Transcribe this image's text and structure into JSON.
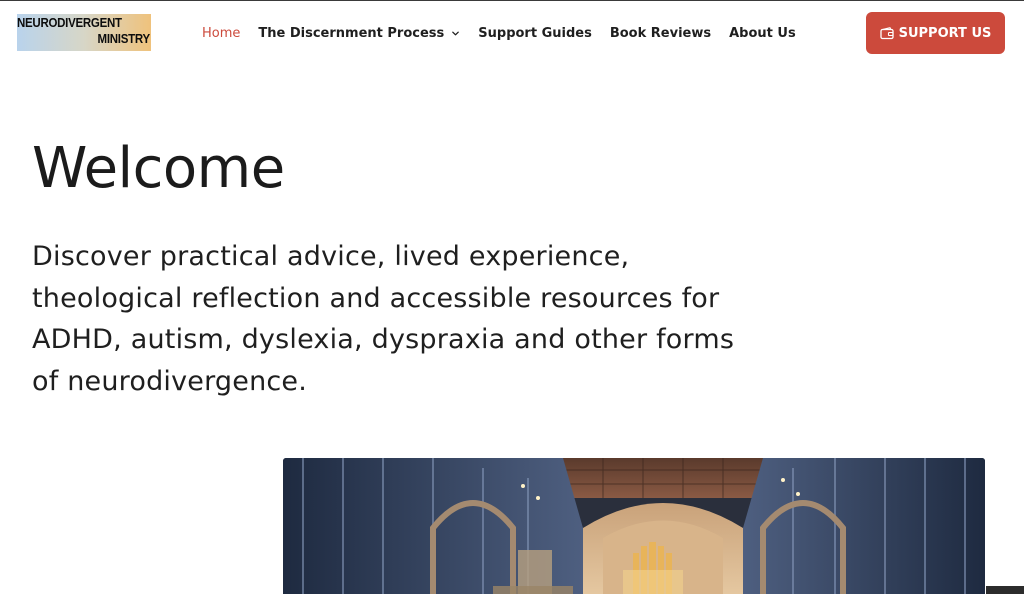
{
  "header": {
    "logo": {
      "line1": "NEURODIVERGENT",
      "line2": "MINISTRY"
    },
    "nav": [
      {
        "label": "Home",
        "active": true
      },
      {
        "label": "The Discernment Process",
        "dropdown": true
      },
      {
        "label": "Support Guides"
      },
      {
        "label": "Book Reviews"
      },
      {
        "label": "About Us"
      }
    ],
    "support_button": {
      "label": "SUPPORT US",
      "icon": "wallet-icon"
    }
  },
  "hero": {
    "title": "Welcome",
    "intro": "Discover practical advice, lived experience, theological reflection and accessible resources for ADHD, autism, dyslexia, dyspraxia and other forms of neurodivergence."
  },
  "colors": {
    "accent": "#cc4a3c",
    "text": "#1f1f1f",
    "background": "#ffffff"
  }
}
